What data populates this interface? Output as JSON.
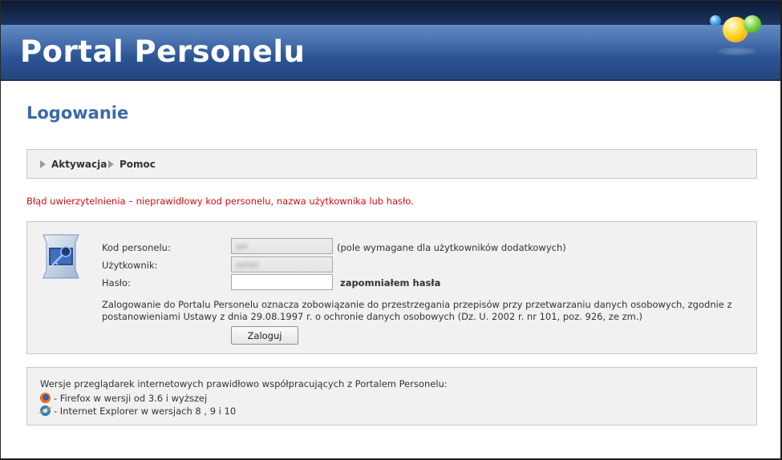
{
  "header": {
    "title": "Portal Personelu"
  },
  "page": {
    "title": "Logowanie"
  },
  "nav": {
    "items": [
      {
        "label": "Aktywacja"
      },
      {
        "label": "Pomoc"
      }
    ]
  },
  "error": {
    "message": "Błąd uwierzytelnienia – nieprawidłowy kod personelu, nazwa użytkownika lub hasło."
  },
  "login": {
    "code_label": "Kod personelu:",
    "code_value": "sel",
    "code_hint": "(pole wymagane dla użytkowników dodatkowych)",
    "user_label": "Użytkownik:",
    "user_value": "sehel",
    "password_label": "Hasło:",
    "password_value": "",
    "forgot_label": "zapomniałem hasła",
    "note": "Zalogowanie do Portalu Personelu oznacza zobowiązanie do przestrzegania przepisów przy przetwarzaniu danych osobowych, zgodnie z postanowieniami Ustawy z dnia 29.08.1997 r. o ochronie danych osobowych (Dz. U. 2002 r. nr 101, poz. 926, ze zm.)",
    "submit_label": "Zaloguj"
  },
  "browsers": {
    "intro": "Wersje przeglądarek internetowych prawidłowo współpracujących z Portalem Personelu:",
    "items": [
      {
        "icon": "firefox-icon",
        "text": "- Firefox w wersji od 3.6 i wyższej"
      },
      {
        "icon": "internet-explorer-icon",
        "text": "- Internet Explorer w wersjach 8 , 9 i 10"
      }
    ]
  },
  "colors": {
    "header_blue": "#2c5597",
    "title_blue": "#3b6aa6",
    "error_red": "#cc1111",
    "panel_gray": "#f1f1f1"
  }
}
